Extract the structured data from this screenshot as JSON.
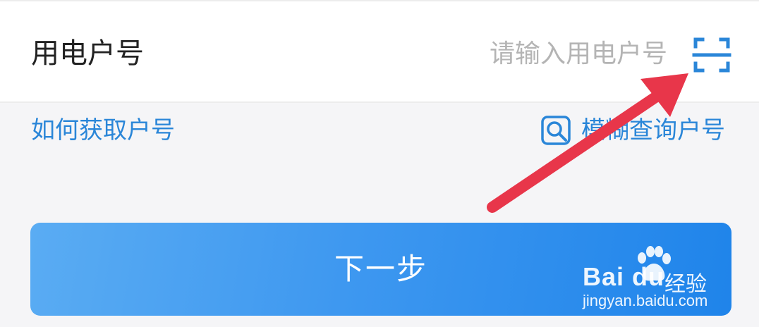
{
  "form": {
    "field_label": "用电户号",
    "input_placeholder": "请输入用电户号",
    "input_value": "",
    "scan_icon": "scan-icon"
  },
  "links": {
    "how_to_get": "如何获取户号",
    "fuzzy_query": "模糊查询户号",
    "fuzzy_icon": "search-icon"
  },
  "actions": {
    "next_label": "下一步"
  },
  "annotation": {
    "arrow_color": "#e8364a"
  },
  "watermark": {
    "logo": "Bai du",
    "product": "经验",
    "url": "jingyan.baidu.com"
  },
  "colors": {
    "accent": "#2a86d8",
    "button_start": "#5aacf3",
    "button_end": "#1f84ea",
    "background": "#f5f5f7"
  }
}
